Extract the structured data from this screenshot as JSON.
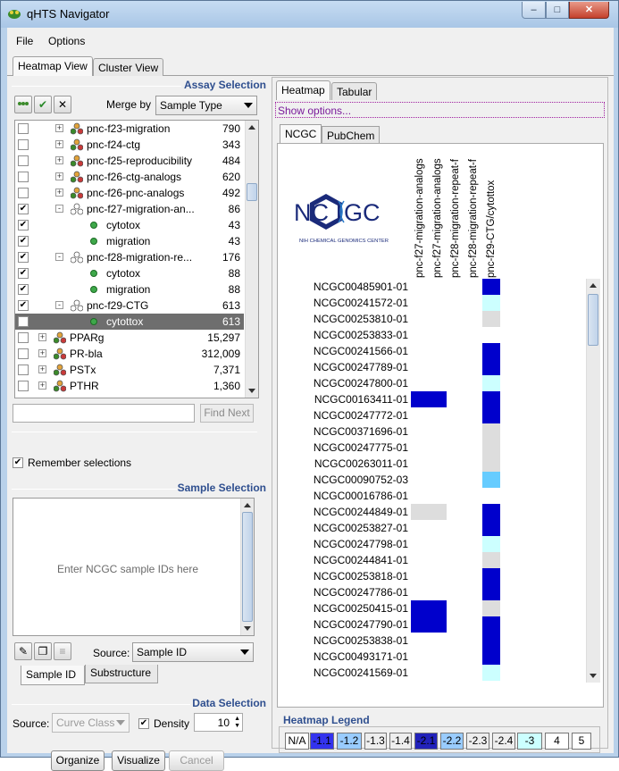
{
  "window": {
    "title": "qHTS Navigator"
  },
  "menu": [
    "File",
    "Options"
  ],
  "main_tabs": [
    "Heatmap View",
    "Cluster View"
  ],
  "assay_selection": {
    "title": "Assay Selection",
    "merge_label": "Merge by",
    "merge_value": "Sample Type",
    "tree": [
      {
        "label": "pnc-f23-migration",
        "count": "790",
        "checked": false
      },
      {
        "label": "pnc-f24-ctg",
        "count": "343",
        "checked": false
      },
      {
        "label": "pnc-f25-reproducibility",
        "count": "484",
        "checked": false
      },
      {
        "label": "pnc-f26-ctg-analogs",
        "count": "620",
        "checked": false
      },
      {
        "label": "pnc-f26-pnc-analogs",
        "count": "492",
        "checked": false
      },
      {
        "label": "pnc-f27-migration-an...",
        "count": "86",
        "checked": true
      },
      {
        "label": "cytotox",
        "count": "43",
        "checked": true
      },
      {
        "label": "migration",
        "count": "43",
        "checked": true
      },
      {
        "label": "pnc-f28-migration-re...",
        "count": "176",
        "checked": true
      },
      {
        "label": "cytotox",
        "count": "88",
        "checked": true
      },
      {
        "label": "migration",
        "count": "88",
        "checked": true
      },
      {
        "label": "pnc-f29-CTG",
        "count": "613",
        "checked": true
      },
      {
        "label": "cytottox",
        "count": "613",
        "checked": true
      },
      {
        "label": "PPARg",
        "count": "15,297",
        "checked": false
      },
      {
        "label": "PR-bla",
        "count": "312,009",
        "checked": false
      },
      {
        "label": "PSTx",
        "count": "7,371",
        "checked": false
      },
      {
        "label": "PTHR",
        "count": "1,360",
        "checked": false
      }
    ],
    "find_placeholder": "",
    "find_next": "Find Next",
    "remember": "Remember selections"
  },
  "sample_selection": {
    "title": "Sample Selection",
    "placeholder": "Enter NCGC sample IDs here",
    "source_label": "Source:",
    "source_value": "Sample ID",
    "tabs": [
      "Sample ID",
      "Substructure"
    ]
  },
  "data_selection": {
    "title": "Data Selection",
    "source_label": "Source:",
    "source_value": "Curve Class",
    "density_label": "Density",
    "density_value": "10"
  },
  "buttons": {
    "organize": "Organize",
    "visualize": "Visualize",
    "cancel": "Cancel"
  },
  "right_tabs": [
    "Heatmap",
    "Tabular"
  ],
  "show_options": "Show options...",
  "source_tabs": [
    "NCGC",
    "PubChem"
  ],
  "logo": {
    "letters": "NCGC",
    "subtitle": "NIH CHEMICAL GENOMICS CENTER"
  },
  "heatmap": {
    "columns": [
      "pnc-f27-migration-analogs",
      "pnc-f27-migration-analogs",
      "pnc-f28-migration-repeat-f",
      "pnc-f28-migration-repeat-f",
      "pnc-f29-CTG/cytottox"
    ],
    "rows": [
      {
        "id": "NCGC00485901-01",
        "cells": [
          null,
          null,
          null,
          null,
          "#0000cc"
        ]
      },
      {
        "id": "NCGC00241572-01",
        "cells": [
          null,
          null,
          null,
          null,
          "#ccffff"
        ]
      },
      {
        "id": "NCGC00253810-01",
        "cells": [
          null,
          null,
          null,
          null,
          "#dddddd"
        ]
      },
      {
        "id": "NCGC00253833-01",
        "cells": [
          null,
          null,
          null,
          null,
          null
        ]
      },
      {
        "id": "NCGC00241566-01",
        "cells": [
          null,
          null,
          null,
          null,
          "#0000cc"
        ]
      },
      {
        "id": "NCGC00247789-01",
        "cells": [
          null,
          null,
          null,
          null,
          "#0000cc"
        ]
      },
      {
        "id": "NCGC00247800-01",
        "cells": [
          null,
          null,
          null,
          null,
          "#ccffff"
        ]
      },
      {
        "id": "NCGC00163411-01",
        "cells": [
          "#0000cc",
          "#0000cc",
          null,
          null,
          "#0000cc"
        ]
      },
      {
        "id": "NCGC00247772-01",
        "cells": [
          null,
          null,
          null,
          null,
          "#0000cc"
        ]
      },
      {
        "id": "NCGC00371696-01",
        "cells": [
          null,
          null,
          null,
          null,
          "#dddddd"
        ]
      },
      {
        "id": "NCGC00247775-01",
        "cells": [
          null,
          null,
          null,
          null,
          "#dddddd"
        ]
      },
      {
        "id": "NCGC00263011-01",
        "cells": [
          null,
          null,
          null,
          null,
          "#dddddd"
        ]
      },
      {
        "id": "NCGC00090752-03",
        "cells": [
          null,
          null,
          null,
          null,
          "#66ccff"
        ]
      },
      {
        "id": "NCGC00016786-01",
        "cells": [
          null,
          null,
          null,
          null,
          null
        ]
      },
      {
        "id": "NCGC00244849-01",
        "cells": [
          "#dddddd",
          "#dddddd",
          null,
          null,
          "#0000cc"
        ]
      },
      {
        "id": "NCGC00253827-01",
        "cells": [
          null,
          null,
          null,
          null,
          "#0000cc"
        ]
      },
      {
        "id": "NCGC00247798-01",
        "cells": [
          null,
          null,
          null,
          null,
          "#ccffff"
        ]
      },
      {
        "id": "NCGC00244841-01",
        "cells": [
          null,
          null,
          null,
          null,
          "#dddddd"
        ]
      },
      {
        "id": "NCGC00253818-01",
        "cells": [
          null,
          null,
          null,
          null,
          "#0000cc"
        ]
      },
      {
        "id": "NCGC00247786-01",
        "cells": [
          null,
          null,
          null,
          null,
          "#0000cc"
        ]
      },
      {
        "id": "NCGC00250415-01",
        "cells": [
          "#0000cc",
          "#0000cc",
          null,
          null,
          "#dddddd"
        ]
      },
      {
        "id": "NCGC00247790-01",
        "cells": [
          "#0000cc",
          "#0000cc",
          null,
          null,
          "#0000cc"
        ]
      },
      {
        "id": "NCGC00253838-01",
        "cells": [
          null,
          null,
          null,
          null,
          "#0000cc"
        ]
      },
      {
        "id": "NCGC00493171-01",
        "cells": [
          null,
          null,
          null,
          null,
          "#0000cc"
        ]
      },
      {
        "id": "NCGC00241569-01",
        "cells": [
          null,
          null,
          null,
          null,
          "#ccffff"
        ]
      }
    ]
  },
  "legend": {
    "title": "Heatmap Legend",
    "items": [
      {
        "label": "N/A",
        "color": "#ffffff"
      },
      {
        "label": "-1.1",
        "color": "#3333ee"
      },
      {
        "label": "-1.2",
        "color": "#99ccff"
      },
      {
        "label": "-1.3",
        "color": "#eeeeee"
      },
      {
        "label": "-1.4",
        "color": "#eeeeee"
      },
      {
        "label": "-2.1",
        "color": "#2222bb"
      },
      {
        "label": "-2.2",
        "color": "#99ccff"
      },
      {
        "label": "-2.3",
        "color": "#eeeeee"
      },
      {
        "label": "-2.4",
        "color": "#eeeeee"
      },
      {
        "label": "-3",
        "color": "#ccffff"
      },
      {
        "label": "4",
        "color": "#ffffff"
      },
      {
        "label": "5",
        "color": "#ffffff"
      }
    ]
  },
  "colors": {
    "group_title": "#2f4f8f",
    "active": "#0000cc",
    "inactive": "#dddddd"
  }
}
